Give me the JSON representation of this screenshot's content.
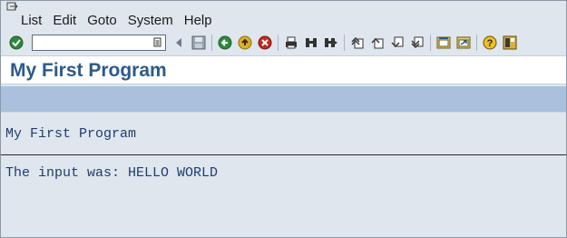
{
  "menu": {
    "items": [
      "List",
      "Edit",
      "Goto",
      "System",
      "Help"
    ]
  },
  "toolbar": {
    "command_field_value": "",
    "icons": [
      "enter-icon",
      "command-dropdown-icon",
      "back-arrow-icon",
      "save-icon",
      "back-icon",
      "exit-icon",
      "cancel-icon",
      "print-icon",
      "find-icon",
      "find-next-icon",
      "first-page-icon",
      "previous-page-icon",
      "next-page-icon",
      "last-page-icon",
      "new-session-icon",
      "shortcut-icon",
      "help-icon",
      "layout-icon"
    ]
  },
  "title": {
    "text": "My First Program"
  },
  "list": {
    "header": "My First Program",
    "line1": "The input was: HELLO WORLD"
  },
  "colors": {
    "title_text": "#2c5a8c",
    "app_band": "#a9c1dc",
    "background": "#dfe6ee",
    "list_text": "#1e3d6e"
  }
}
